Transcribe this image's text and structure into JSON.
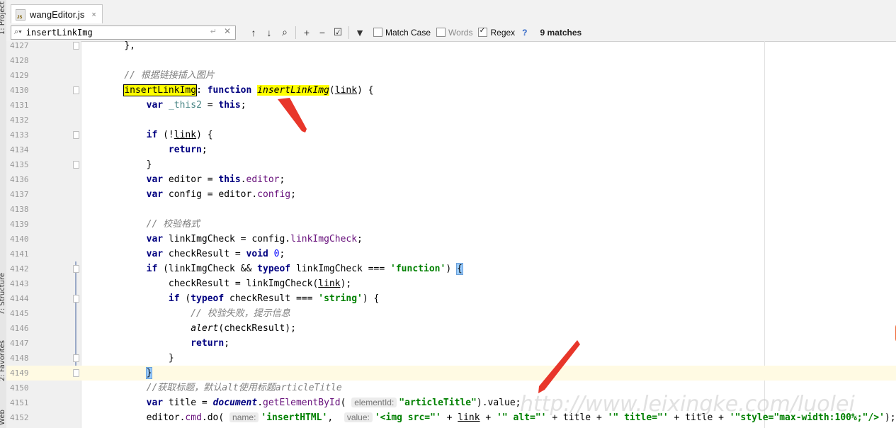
{
  "side_panel": {
    "project_label": "1: Project",
    "structure_label": "7: Structure",
    "favorites_label": "2: Favorites",
    "web_label": "Web"
  },
  "tab": {
    "label": "wangEditor.js",
    "icon": "js-file-icon",
    "close": "×"
  },
  "find": {
    "query": "insertLinkImg",
    "options": {
      "match_case": "Match Case",
      "words": "Words",
      "regex": "Regex"
    },
    "states": {
      "match_case": false,
      "words": false,
      "regex": true
    },
    "help": "?",
    "matches": "9 matches"
  },
  "editor": {
    "current_line": "4149",
    "lines": [
      {
        "n": "4127"
      },
      {
        "n": "4128"
      },
      {
        "n": "4129"
      },
      {
        "n": "4130"
      },
      {
        "n": "4131"
      },
      {
        "n": "4132"
      },
      {
        "n": "4133"
      },
      {
        "n": "4134"
      },
      {
        "n": "4135"
      },
      {
        "n": "4136"
      },
      {
        "n": "4137"
      },
      {
        "n": "4138"
      },
      {
        "n": "4139"
      },
      {
        "n": "4140"
      },
      {
        "n": "4141"
      },
      {
        "n": "4142"
      },
      {
        "n": "4143"
      },
      {
        "n": "4144"
      },
      {
        "n": "4145"
      },
      {
        "n": "4146"
      },
      {
        "n": "4147"
      },
      {
        "n": "4148"
      },
      {
        "n": "4149"
      },
      {
        "n": "4150"
      },
      {
        "n": "4151"
      },
      {
        "n": "4152"
      }
    ],
    "tokens": {
      "l4127": "},",
      "l4129": "// 根据链接插入图片",
      "l4130_a": "insertLinkImg",
      "l4130_b": ": ",
      "l4130_c": "function",
      "l4130_d": " ",
      "l4130_e": "insertLinkImg",
      "l4130_f": "(",
      "l4130_g": "link",
      "l4130_h": ") {",
      "l4131_a": "var",
      "l4131_b": " ",
      "l4131_c": "_this2",
      "l4131_d": " = ",
      "l4131_e": "this",
      "l4131_f": ";",
      "l4133_a": "if",
      "l4133_b": " (!",
      "l4133_c": "link",
      "l4133_d": ") {",
      "l4134": "return",
      "l4134_b": ";",
      "l4135": "}",
      "l4136_a": "var",
      "l4136_b": " editor = ",
      "l4136_c": "this",
      "l4136_d": ".",
      "l4136_e": "editor",
      "l4136_f": ";",
      "l4137_a": "var",
      "l4137_b": " config = editor.",
      "l4137_c": "config",
      "l4137_d": ";",
      "l4139": "// 校验格式",
      "l4140_a": "var",
      "l4140_b": " linkImgCheck = config.",
      "l4140_c": "linkImgCheck",
      "l4140_d": ";",
      "l4141_a": "var",
      "l4141_b": " checkResult = ",
      "l4141_c": "void",
      "l4141_d": " ",
      "l4141_e": "0",
      "l4141_f": ";",
      "l4142_a": "if",
      "l4142_b": " (linkImgCheck && ",
      "l4142_c": "typeof",
      "l4142_d": " linkImgCheck === ",
      "l4142_e": "'function'",
      "l4142_f": ") ",
      "l4142_g": "{",
      "l4143_a": "checkResult = linkImgCheck(",
      "l4143_b": "link",
      "l4143_c": ");",
      "l4144_a": "if",
      "l4144_b": " (",
      "l4144_c": "typeof",
      "l4144_d": " checkResult === ",
      "l4144_e": "'string'",
      "l4144_f": ") {",
      "l4145": "// 校验失败，提示信息",
      "l4146_a": "alert",
      "l4146_b": "(checkResult);",
      "l4147_a": "return",
      "l4147_b": ";",
      "l4148": "}",
      "l4149": "}",
      "l4150": "//获取标题，默认alt使用标题articleTitle",
      "l4151_a": "var",
      "l4151_b": " title = ",
      "l4151_c": "document",
      "l4151_d": ".",
      "l4151_e": "getElementById",
      "l4151_f": "( ",
      "l4151_hint": "elementId:",
      "l4151_g": "\"articleTitle\"",
      "l4151_h": ").value;",
      "l4152_a": "editor.",
      "l4152_b": "cmd",
      "l4152_c": ".do( ",
      "l4152_hint1": "name:",
      "l4152_d": "'insertHTML'",
      "l4152_e": ",  ",
      "l4152_hint2": "value:",
      "l4152_f": "'<img src=\"'",
      "l4152_g": " + ",
      "l4152_h": "link",
      "l4152_i": " + ",
      "l4152_j": "'\" alt=\"'",
      "l4152_k": " + title + ",
      "l4152_l": "'\" title=\"'",
      "l4152_m": " + title + ",
      "l4152_n": "'\"style=\"max-width:100%;\"/>'",
      "l4152_o": ");"
    }
  },
  "watermark": "http://www.leixingke.com/luolei",
  "colors": {
    "keyword": "#000080",
    "string": "#008000",
    "comment": "#808080",
    "property": "#660e7a",
    "highlight": "#ffff00",
    "arrow": "#e8362a"
  }
}
